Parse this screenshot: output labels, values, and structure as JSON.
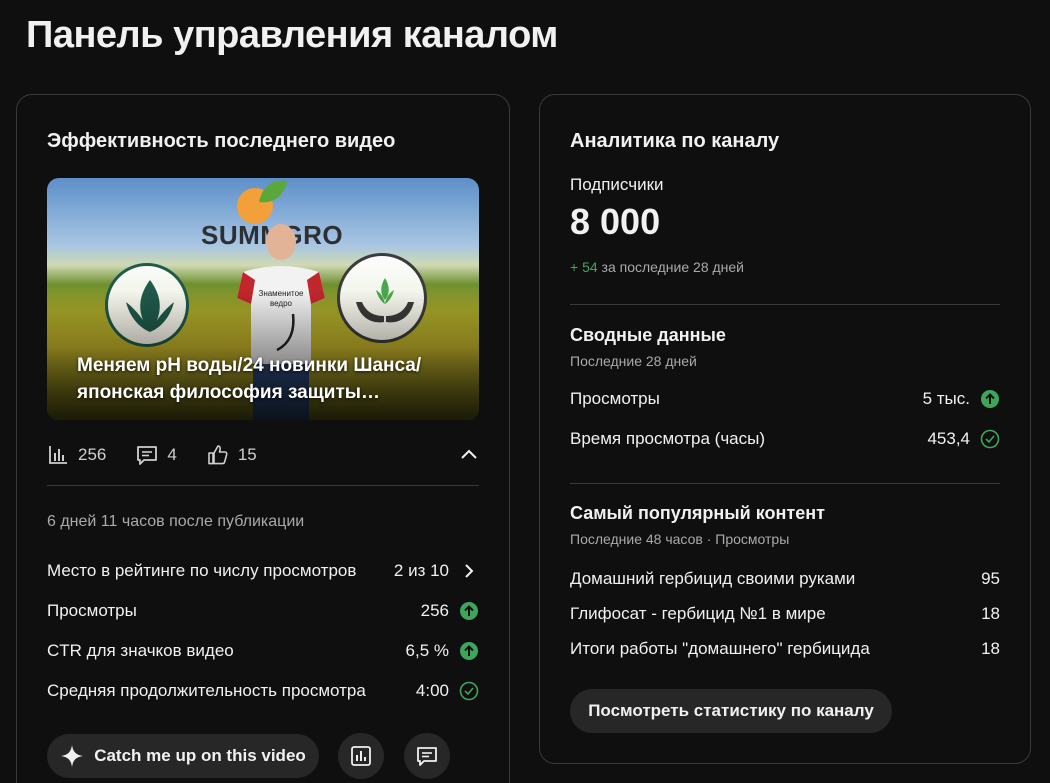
{
  "page": {
    "title": "Панель управления каналом"
  },
  "latest_video": {
    "card_title": "Эффективность последнего видео",
    "thumbnail": {
      "title": "Меняем pH воды/24 новинки Шанса/ японская философия защиты…",
      "brand_text": "SUMMGRO",
      "shirt_text": "Знаменитое ведро"
    },
    "stats": {
      "views": "256",
      "comments": "4",
      "likes": "15"
    },
    "published": "6 дней 11 часов после публикации",
    "metrics": [
      {
        "label": "Место в рейтинге по числу просмотров",
        "value": "2 из 10",
        "icon": "chevron-right-icon"
      },
      {
        "label": "Просмотры",
        "value": "256",
        "icon": "arrow-up-green-icon"
      },
      {
        "label": "CTR для значков видео",
        "value": "6,5 %",
        "icon": "arrow-up-green-icon"
      },
      {
        "label": "Средняя продолжительность просмотра",
        "value": "4:00",
        "icon": "check-circle-icon"
      }
    ],
    "catch_up_label": "Catch me up on this video"
  },
  "channel_analytics": {
    "card_title": "Аналитика по каналу",
    "subscribers_label": "Подписчики",
    "subscribers_value": "8 000",
    "subscribers_change": "+ 54",
    "subscribers_period": "за последние 28 дней",
    "summary": {
      "title": "Сводные данные",
      "period": "Последние 28 дней",
      "rows": [
        {
          "label": "Просмотры",
          "value": "5 тыс.",
          "icon": "arrow-up-green-icon"
        },
        {
          "label": "Время просмотра (часы)",
          "value": "453,4",
          "icon": "check-circle-icon"
        }
      ]
    },
    "top_content": {
      "title": "Самый популярный контент",
      "period": "Последние 48 часов · Просмотры",
      "rows": [
        {
          "label": "Домашний гербицид своими руками",
          "value": "95"
        },
        {
          "label": "Глифосат - гербицид №1 в мире",
          "value": "18"
        },
        {
          "label": "Итоги работы \"домашнего\" гербицида",
          "value": "18"
        }
      ]
    },
    "view_stats_label": "Посмотреть статистику по каналу"
  },
  "colors": {
    "accent_green": "#3ea65c",
    "card_border": "#3a3a3a",
    "background": "#0f0f0f",
    "button_bg": "#272727"
  }
}
